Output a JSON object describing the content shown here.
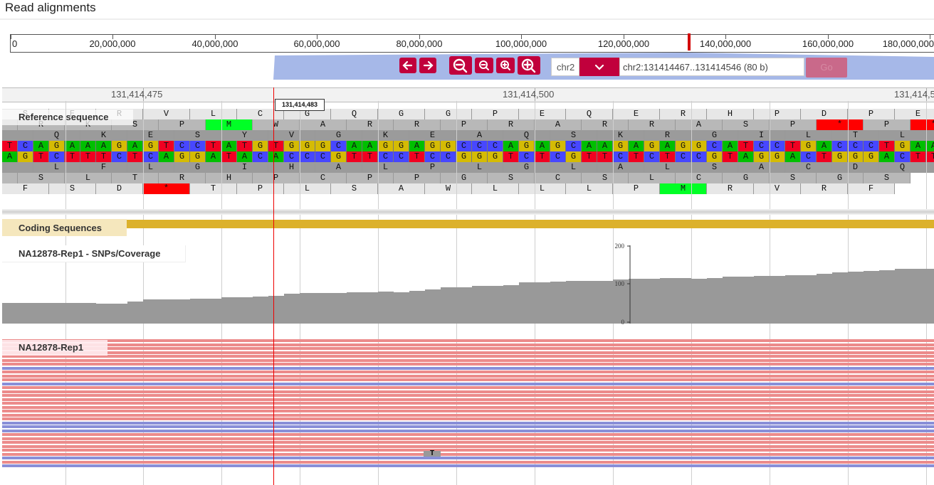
{
  "page": {
    "title": "Read alignments"
  },
  "overview": {
    "labels": [
      "0",
      "20,000,000",
      "40,000,000",
      "60,000,000",
      "80,000,000",
      "100,000,000",
      "120,000,000",
      "140,000,000",
      "160,000,000",
      "180,000,000"
    ]
  },
  "nav": {
    "chromosome": "chr2",
    "location": "chr2:131414467..131414546 (80 b)",
    "go_label": "Go"
  },
  "ruler": {
    "labels": [
      "131,414,475",
      "131,414,500",
      "131,414,5"
    ],
    "cursor": "131,414,483"
  },
  "tracks": {
    "reference": "Reference sequence",
    "cds": "Coding Sequences",
    "coverage": "NA12878-Rep1 - SNPs/Coverage",
    "reads": "NA12878-Rep1"
  },
  "coverage_axis": {
    "ticks": [
      "200",
      "100",
      "0"
    ]
  },
  "reference": {
    "forward_strand": "TCAGAAAGAGTCCTATGTGGGCAAGGAGGCCCAGAGCAAGAGAGGCATCCTGACCCTGAA",
    "reverse_strand": "AGTCTTTCTCAGGATACACCCGTTCCTCCGGGTCTCGTTCTCTCCGTAGGACTGGGACTT",
    "frames": [
      {
        "offset": 0,
        "aa": " SERVLCGQGGPEQERHPDPE"
      },
      {
        "offset": 1,
        "aa": "IRKSPMWARRPRARRASP*P*"
      },
      {
        "offset": 2,
        "aa": " QKESYVGKEAQSKRGILTLK"
      },
      {
        "offset": 2,
        "aa": " LFLGIHALPLGLALSACDQGQ"
      },
      {
        "offset": 1,
        "aa": "DSLTRHPCPPGSCSLCGSGS"
      },
      {
        "offset": 0,
        "aa": "*FSD*TPLSAWLLLPMRVRF"
      }
    ]
  },
  "colors": {
    "A": "#00bf00",
    "C": "#4747ff",
    "G": "#d5bb04",
    "T": "#f10021",
    "accent": "#c1003c",
    "coverage": "#999999",
    "read_forward": "#ec8b8b",
    "read_reverse": "#898fd8"
  }
}
